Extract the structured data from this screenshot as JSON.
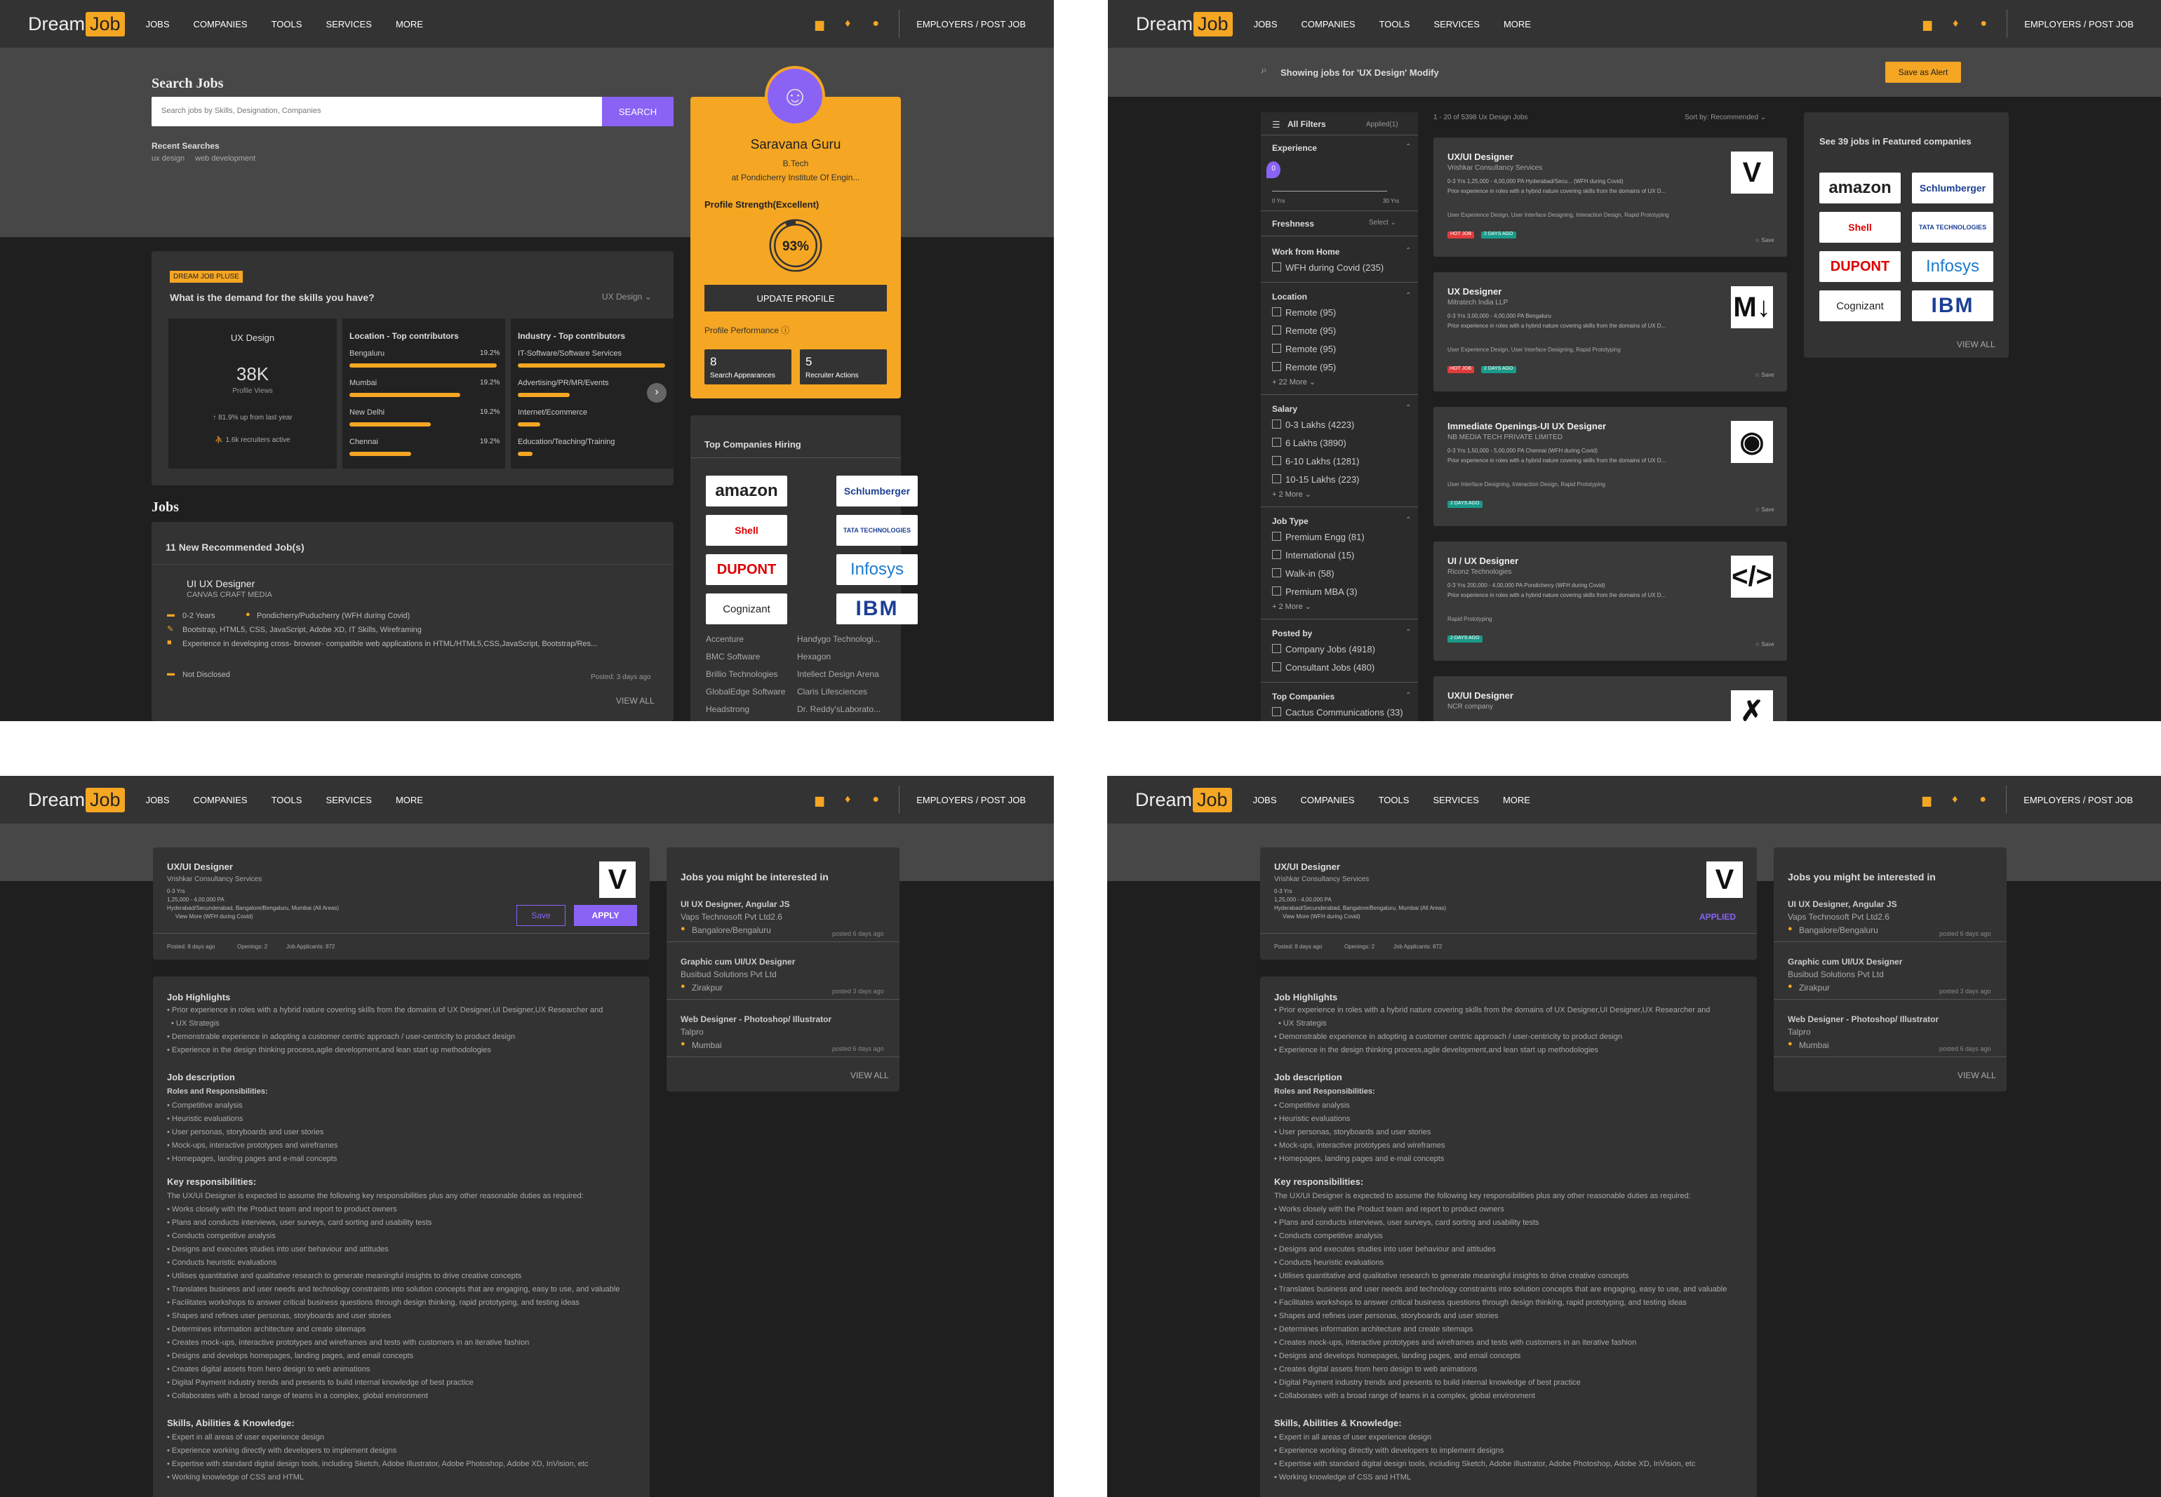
{
  "nav": {
    "logo_a": "Dream",
    "logo_b": "Job",
    "items": [
      "JOBS",
      "COMPANIES",
      "TOOLS",
      "SERVICES",
      "MORE"
    ],
    "employers": "EMPLOYERS / POST JOB"
  },
  "p1": {
    "search_title": "Search Jobs",
    "search_placeholder": "Search jobs by Skills, Designation, Companies",
    "search_btn": "SEARCH",
    "recent_title": "Recent Searches",
    "recent": [
      "ux design",
      "web development"
    ],
    "profile": {
      "name": "Saravana Guru",
      "degree": "B.Tech",
      "college": "at Pondicherry Institute Of Engin...",
      "strength": "Profile Strength(Excellent)",
      "pct": "93%",
      "pct_value": 0.93,
      "update": "UPDATE PROFILE",
      "performance": "Profile Performance ⓘ",
      "search_app_num": "8",
      "search_app": "Search Appearances",
      "rec_num": "5",
      "rec": "Recruiter Actions"
    },
    "demand": {
      "badge": "DREAM JOB PLUSE",
      "question": "What is the demand for the skills you have?",
      "filter": "UX Design ⌄",
      "skill": "UX Design",
      "views": "38K",
      "views_label": "Profile Views",
      "growth": "↑ 81.9% up from last year",
      "recruiters": "⛹ 1.6k recruiters active",
      "loc_title": "Location - Top contributors",
      "locs": [
        {
          "name": "Bengaluru",
          "pct": "19.2%",
          "fill": 1
        },
        {
          "name": "Mumbai",
          "pct": "19.2%",
          "fill": 0.75
        },
        {
          "name": "New Delhi",
          "pct": "19.2%",
          "fill": 0.55
        },
        {
          "name": "Chennai",
          "pct": "19.2%",
          "fill": 0.42
        }
      ],
      "ind_title": "Industry - Top contributors",
      "inds": [
        {
          "name": "IT-Software/Software Services",
          "fill": 1
        },
        {
          "name": "Advertising/PR/MR/Events",
          "fill": 0.35
        },
        {
          "name": "Internet/Ecommerce",
          "fill": 0.15
        },
        {
          "name": "Education/Teaching/Training",
          "fill": 0.1
        }
      ]
    },
    "jobs_title": "Jobs",
    "recommended": "11 New Recommended Job(s)",
    "job": {
      "title": "UI UX Designer",
      "company": "CANVAS CRAFT MEDIA",
      "exp": "0-2 Years",
      "loc": "Pondicherry/Puducherry (WFH during Covid)",
      "skills": "Bootstrap, HTML5, CSS, JavaScript, Adobe XD, IT Skills, Wireframing",
      "desc": "Experience in developing cross- browser- compatible web applications in HTML/HTML5,CSS,JavaScript, Bootstrap/Res...",
      "salary": "Not Disclosed",
      "posted": "Posted: 3 days ago",
      "view_all": "VIEW ALL"
    },
    "top_title": "Top Companies Hiring",
    "logos": [
      "amazon",
      "Schlumberger",
      "Shell",
      "TATA TECHNOLOGIES",
      "DUPONT",
      "Infosys",
      "Cognizant",
      "IBM"
    ],
    "companies": [
      "Accenture",
      "Handygo Technologi...",
      "BMC Software",
      "Hexagon",
      "Brillio Technologies",
      "Intellect Design Arena",
      "GlobalEdge Software",
      "Claris Lifesciences",
      "Headstrong",
      "Dr. Reddy'sLaborato..."
    ]
  },
  "p2": {
    "showing": "Showing jobs for 'UX Design' Modify",
    "save_alert": "Save as Alert",
    "all_filters": "All Filters",
    "applied": "Applied(1)",
    "count": "1 - 20 of 5398 Ux Design Jobs",
    "sort": "Sort by: Recommended ⌄",
    "exp_title": "Experience",
    "exp_min": "0 Yrs",
    "exp_max": "30 Yrs",
    "exp_value": "0",
    "fresh_title": "Freshness",
    "fresh_sel": "Select ⌄",
    "wfh_title": "Work from Home",
    "wfh": [
      "WFH during Covid (235)"
    ],
    "loc_title": "Location",
    "locs": [
      "Remote (95)",
      "Remote (95)",
      "Remote (95)",
      "Remote (95)"
    ],
    "loc_more": "+ 22 More ⌄",
    "sal_title": "Salary",
    "sals": [
      "0-3 Lakhs (4223)",
      "6 Lakhs (3890)",
      "6-10 Lakhs (1281)",
      "10-15 Lakhs (223)"
    ],
    "sal_more": "+ 2 More ⌄",
    "type_title": "Job Type",
    "types": [
      "Premium Engg (81)",
      "International (15)",
      "Walk-in (58)",
      "Premium MBA (3)"
    ],
    "type_more": "+ 2 More ⌄",
    "posted_title": "Posted by",
    "posted": [
      "Company Jobs (4918)",
      "Consultant Jobs (480)"
    ],
    "topc_title": "Top Companies",
    "topc": [
      "Cactus Communications (33)"
    ],
    "jobs": [
      {
        "title": "UX/UI Designer",
        "company": "Vrishkar Consultancy Services",
        "meta": "0-3 Yrs   1,25,000 - 4,00,000 PA   Hyderabad/Secu... (WFH during Covid)",
        "desc": "Prior experience in roles with a hybrid nature covering skills from the domains of UX D...",
        "skills": "User Experience Design, User Interface Designing, Interaction Design, Rapid Prototyping",
        "tags": [
          "HOT JOB",
          "2 DAYS AGO"
        ],
        "logo": "V",
        "save": "☆ Save"
      },
      {
        "title": "UX Designer",
        "company": "Mitratech India LLP",
        "meta": "0-3 Yrs   3,00,000 - 4,00,000 PA   Bengaluru",
        "desc": "Prior experience in roles with a hybrid nature covering skills from the domains of UX D...",
        "skills": "User Experience Design, User Interface Designing, Rapid Prototyping",
        "tags": [
          "HOT JOB",
          "2 DAYS AGO"
        ],
        "logo": "M↓",
        "save": "☆ Save"
      },
      {
        "title": "Immediate Openings-UI UX Designer",
        "company": "NB MEDIA TECH PRIVATE LIMITED",
        "meta": "0-3 Yrs   1,50,000 - 5,00,000 PA   Chennai (WFH during Covid)",
        "desc": "Prior experience in roles with a hybrid nature covering skills from the domains of UX D...",
        "skills": "User Interface Designing, Interaction Design, Rapid Prototyping",
        "tags": [
          "2 DAYS AGO"
        ],
        "logo": "◉",
        "save": "☆ Save"
      },
      {
        "title": "UI / UX Designer",
        "company": "Riconz Technologies",
        "meta": "0-3 Yrs   200,000 - 4,00,000 PA   Pondicherry (WFH during Covid)",
        "desc": "Prior experience in roles with a hybrid nature covering skills from the domains of UX D...",
        "skills": "Rapid Prototyping",
        "tags": [
          "2 DAYS AGO"
        ],
        "logo": "</>",
        "save": "☆ Save"
      },
      {
        "title": "UX/UI Designer",
        "company": "NCR company",
        "meta": "",
        "desc": "",
        "skills": "",
        "tags": [],
        "logo": "✗",
        "save": ""
      }
    ],
    "featured_title": "See 39 jobs in Featured companies",
    "featured_view": "VIEW ALL"
  },
  "detail": {
    "title": "UX/UI Designer",
    "company": "Vrishkar Consultancy Services",
    "exp": "0-3 Yrs",
    "salary": "1,25,000 - 4,00,000 PA",
    "loc": "Hyderabad/Secunderabad, Bangalore/Bengaluru, Mumbai (All Areas)",
    "view_more": "View More (WFH during Covid)",
    "save": "Save",
    "apply": "APPLY",
    "applied": "APPLIED",
    "posted": "Posted: 8 days ago",
    "openings": "Openings: 2",
    "applicants": "Job Applicants: 872",
    "hl_title": "Job Highlights",
    "highlights": [
      "Prior experience in roles with a hybrid nature covering skills from the domains of UX Designer,UI Designer,UX Researcher and",
      "UX Strategis",
      "Demonstrable experience in adopting a customer centric approach / user-centricity to product design",
      "Experience in the design thinking process,agile development,and lean start up methodologies"
    ],
    "jd_title": "Job description",
    "roles_title": "Roles and Responsibilities:",
    "roles": [
      "Competitive analysis",
      "Heuristic evaluations",
      "User personas, storyboards and user stories",
      "Mock-ups, interactive prototypes and wireframes",
      "Homepages, landing pages and e-mail concepts"
    ],
    "key_title": "Key responsibilities:",
    "key_intro": "The UX/UI Designer is expected to assume the following key responsibilities plus any other reasonable duties as required:",
    "keys": [
      "Works closely with the Product team and report to product owners",
      "Plans and conducts interviews, user surveys, card sorting and usability tests",
      "Conducts competitive analysis",
      "Designs and executes studies into user behaviour and attitudes",
      "Conducts heuristic evaluations",
      "Utilises quantitative and qualitative research to generate meaningful insights to drive creative concepts",
      "Translates business and user needs and technology constraints into solution concepts that are engaging, easy to use, and valuable",
      "Facilitates workshops to answer critical business questions through design thinking, rapid prototyping, and testing ideas",
      "Shapes and refines user personas, storyboards and user stories",
      "Determines information architecture and create sitemaps",
      "Creates mock-ups, interactive prototypes and wireframes and tests with customers in an iterative fashion",
      "Designs and develops homepages, landing pages, and email concepts",
      "Creates digital assets from hero design to web animations",
      "Digital Payment industry trends and presents to build internal knowledge of best practice",
      "Collaborates with a broad range of teams in a complex, global environment"
    ],
    "skills_title": "Skills, Abilities & Knowledge:",
    "skills": [
      "Expert in all areas of user experience design",
      "Experience working directly with developers to implement designs",
      "Expertise with standard digital design tools, including Sketch, Adobe Illustrator, Adobe Photoshop, Adobe XD, InVision, etc",
      "Working knowledge of CSS and HTML"
    ],
    "side_title": "Jobs you might be interested in",
    "side": [
      {
        "title": "UI UX Designer, Angular JS",
        "company": "Vaps Technosoft Pvt Ltd2.6",
        "loc": "Bangalore/Bengaluru",
        "posted": "posted 6 days ago"
      },
      {
        "title": "Graphic cum UI/UX Designer",
        "company": "Busibud Solutions Pvt Ltd",
        "loc": "Zirakpur",
        "posted": "posted 3 days ago"
      },
      {
        "title": "Web Designer - Photoshop/ Illustrator",
        "company": "Talpro",
        "loc": "Mumbai",
        "posted": "posted 6 days ago"
      }
    ],
    "side_view": "VIEW ALL"
  }
}
